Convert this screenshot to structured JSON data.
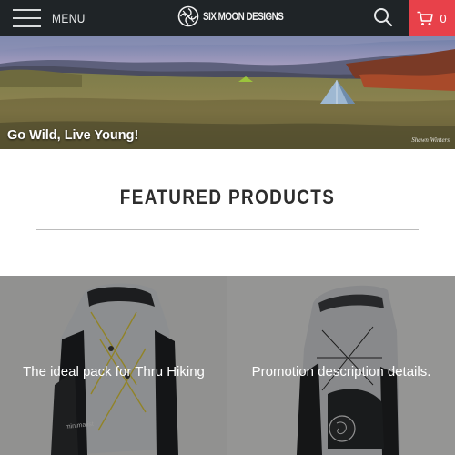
{
  "header": {
    "menu_label": "MENU",
    "brand_name": "SIX MOON DESIGNS",
    "cart_count": "0",
    "icons": [
      "hamburger-icon",
      "moon-logo-icon",
      "search-icon",
      "cart-icon"
    ],
    "background": "#1f2427",
    "accent": "#e8414a"
  },
  "hero": {
    "caption": "Go Wild, Live Young!",
    "signature": "Shawn Winters"
  },
  "featured": {
    "title": "FEATURED PRODUCTS"
  },
  "products": [
    {
      "description": "The ideal pack for Thru Hiking",
      "pack_text": "minimalist"
    },
    {
      "description": "Promotion description details."
    }
  ]
}
